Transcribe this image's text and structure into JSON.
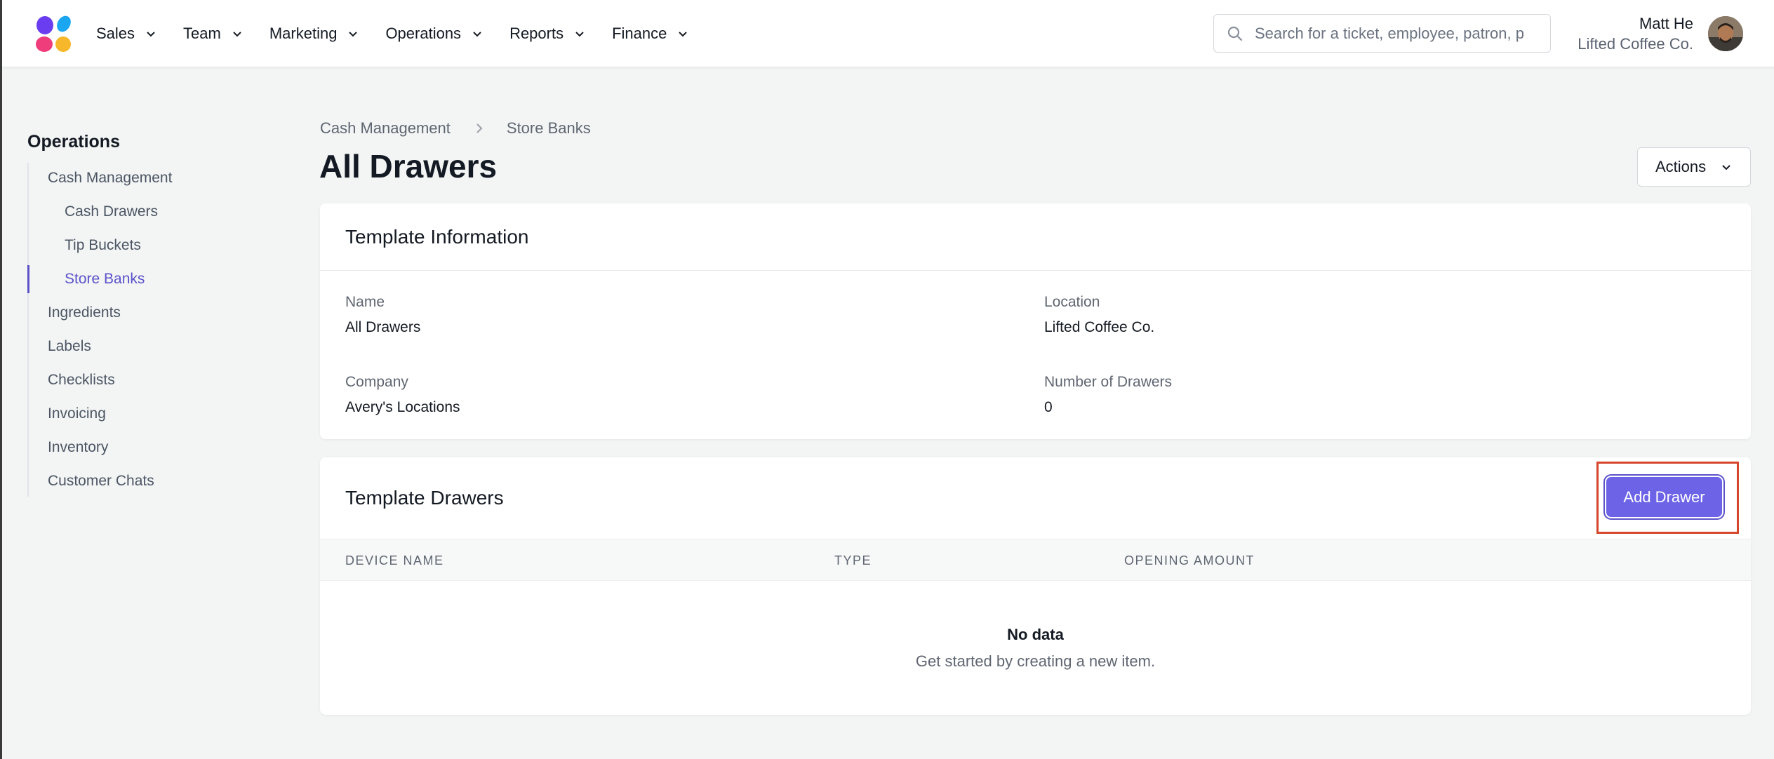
{
  "nav": {
    "items": [
      {
        "label": "Sales"
      },
      {
        "label": "Team"
      },
      {
        "label": "Marketing"
      },
      {
        "label": "Operations"
      },
      {
        "label": "Reports"
      },
      {
        "label": "Finance"
      }
    ]
  },
  "search": {
    "placeholder": "Search for a ticket, employee, patron, p"
  },
  "user": {
    "name": "Matt He",
    "org": "Lifted Coffee Co."
  },
  "sidebar": {
    "title": "Operations",
    "items": [
      {
        "label": "Cash Management"
      },
      {
        "label": "Cash Drawers"
      },
      {
        "label": "Tip Buckets"
      },
      {
        "label": "Store Banks"
      },
      {
        "label": "Ingredients"
      },
      {
        "label": "Labels"
      },
      {
        "label": "Checklists"
      },
      {
        "label": "Invoicing"
      },
      {
        "label": "Inventory"
      },
      {
        "label": "Customer Chats"
      }
    ],
    "active": "Store Banks"
  },
  "breadcrumb": {
    "parent": "Cash Management",
    "current": "Store Banks"
  },
  "page": {
    "title": "All Drawers",
    "actions_label": "Actions"
  },
  "template_info": {
    "title": "Template Information",
    "name_label": "Name",
    "name_value": "All Drawers",
    "location_label": "Location",
    "location_value": "Lifted Coffee Co.",
    "company_label": "Company",
    "company_value": "Avery's Locations",
    "drawers_label": "Number of Drawers",
    "drawers_value": "0"
  },
  "template_drawers": {
    "title": "Template Drawers",
    "add_label": "Add Drawer",
    "columns": [
      "DEVICE NAME",
      "TYPE",
      "OPENING AMOUNT"
    ],
    "empty_title": "No data",
    "empty_subtitle": "Get started by creating a new item."
  },
  "colors": {
    "accent": "#5b52c9",
    "button": "#6c63e6",
    "highlight": "#d6462b"
  }
}
